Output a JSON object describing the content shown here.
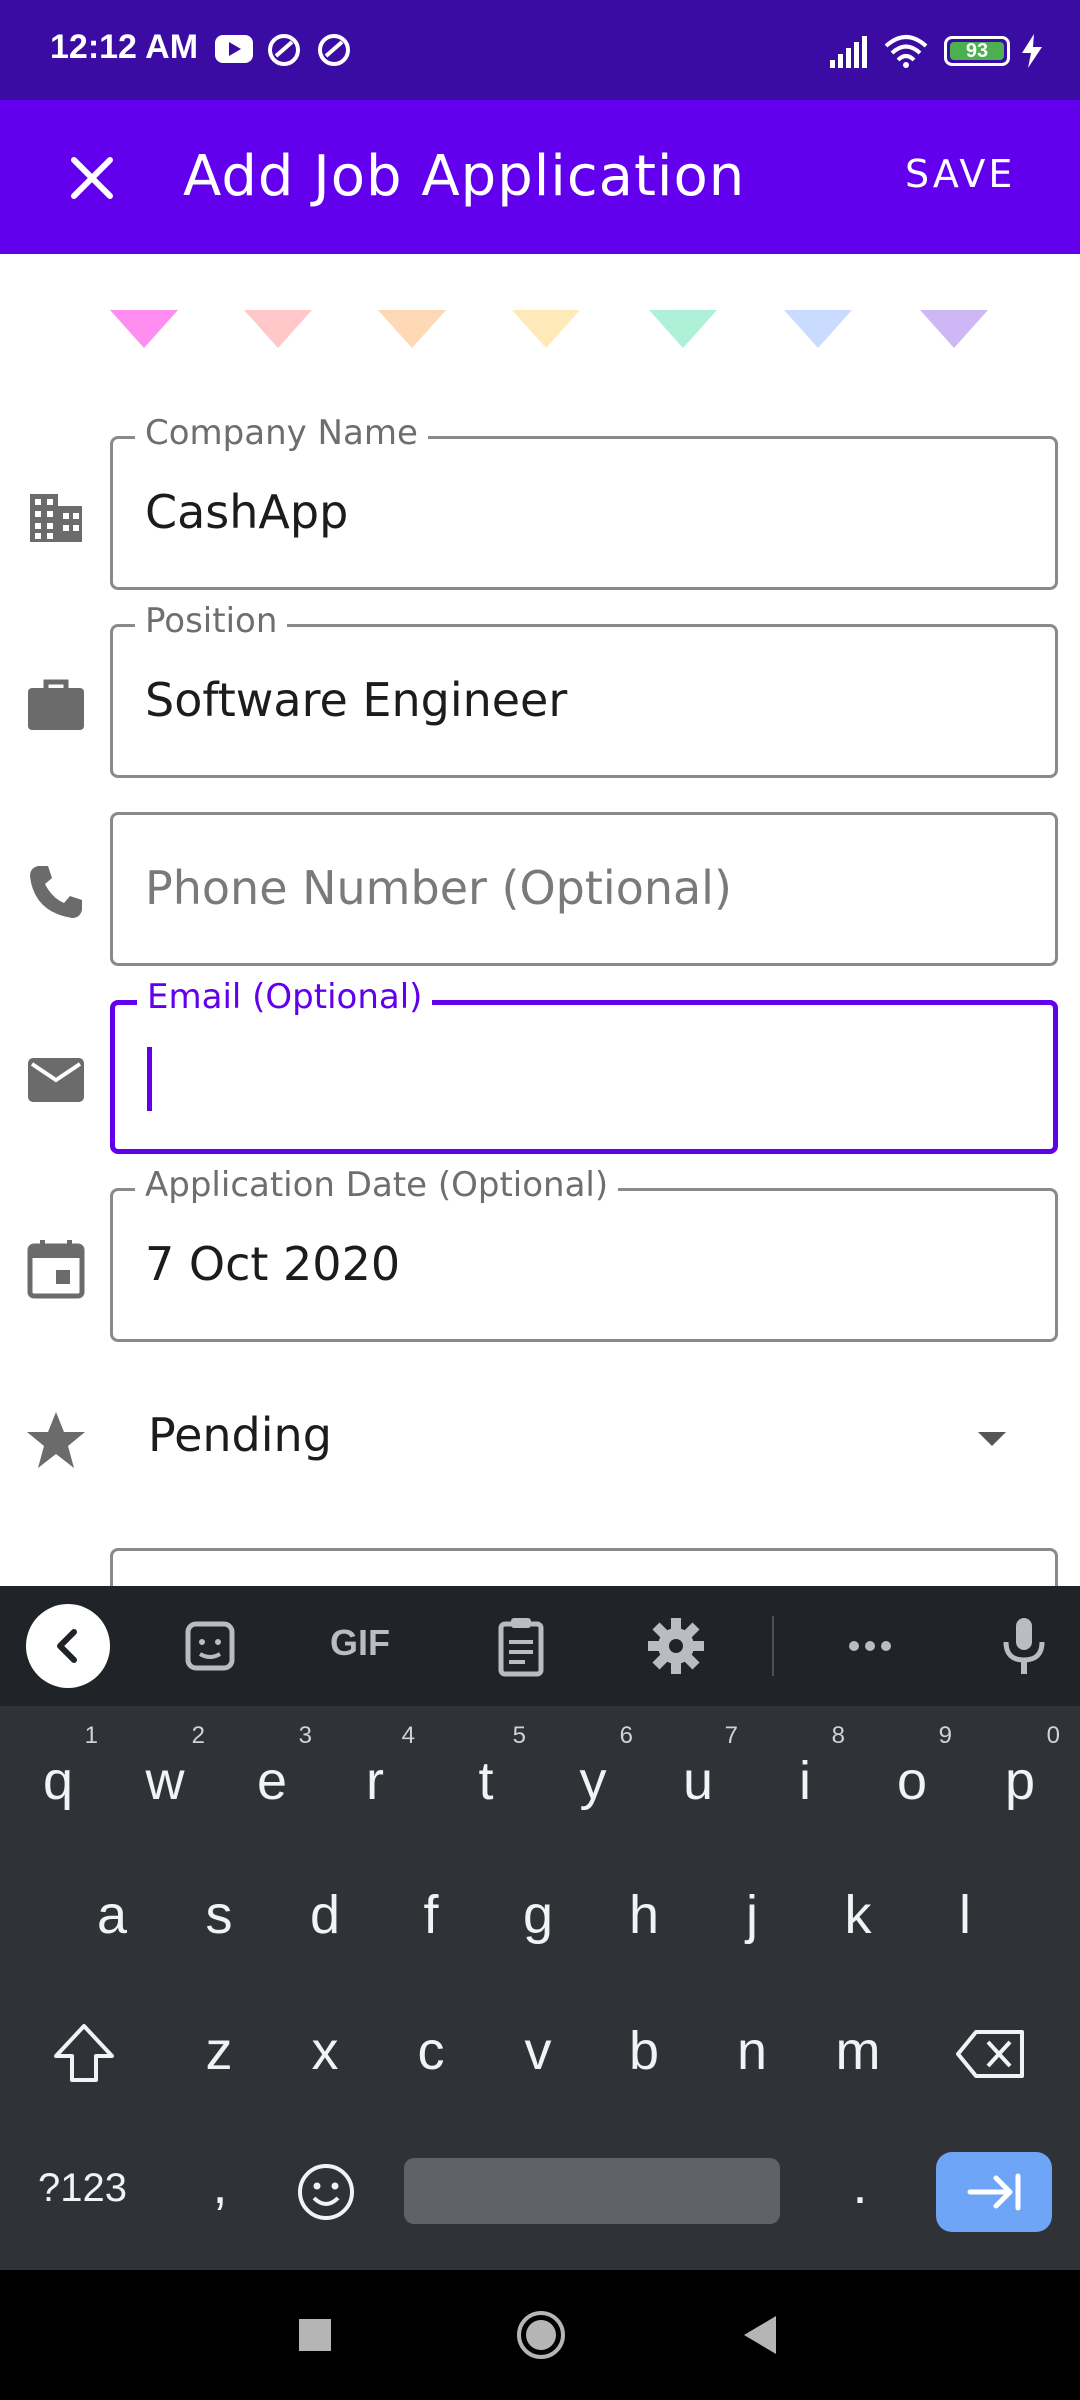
{
  "status_bar": {
    "time": "12:12 AM",
    "battery": "93"
  },
  "app_bar": {
    "title": "Add Job Application",
    "save_label": "SAVE"
  },
  "colors": [
    "#ff8ef0",
    "#ffc7c7",
    "#ffd8b5",
    "#ffe9b8",
    "#aef0d8",
    "#c9dcff",
    "#cdb8f5"
  ],
  "form": {
    "company": {
      "label": "Company Name",
      "value": "CashApp"
    },
    "position": {
      "label": "Position",
      "value": "Software Engineer"
    },
    "phone": {
      "placeholder": "Phone Number (Optional)"
    },
    "email": {
      "label": "Email (Optional)",
      "value": ""
    },
    "date": {
      "label": "Application Date (Optional)",
      "value": "7 Oct 2020"
    },
    "status": {
      "value": "Pending"
    }
  },
  "keyboard": {
    "row1": [
      "q",
      "w",
      "e",
      "r",
      "t",
      "y",
      "u",
      "i",
      "o",
      "p"
    ],
    "row1_hints": [
      "1",
      "2",
      "3",
      "4",
      "5",
      "6",
      "7",
      "8",
      "9",
      "0"
    ],
    "row2": [
      "a",
      "s",
      "d",
      "f",
      "g",
      "h",
      "j",
      "k",
      "l"
    ],
    "row3": [
      "z",
      "x",
      "c",
      "v",
      "b",
      "n",
      "m"
    ],
    "symbols_label": "?123",
    "comma": ",",
    "period": ".",
    "gif_label": "GIF"
  },
  "accent": "#6200ee"
}
